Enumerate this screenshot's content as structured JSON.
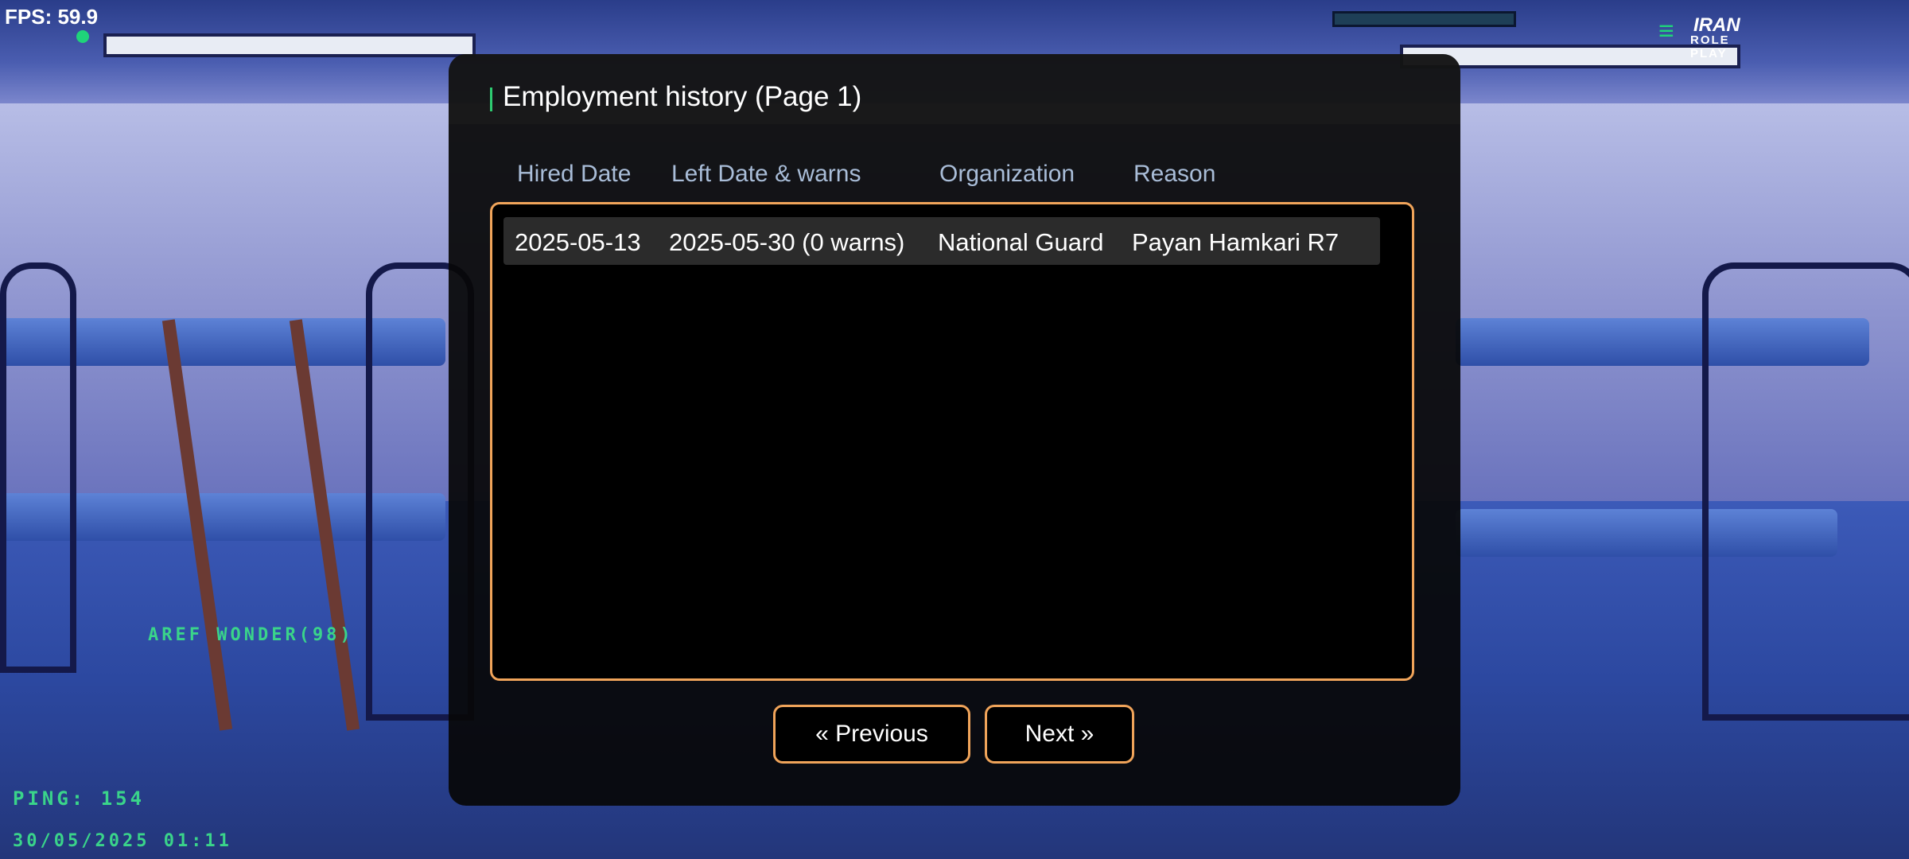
{
  "hud": {
    "fps": "FPS: 59.9",
    "player_tag": "AREF WONDER(98)",
    "ping": "PING: 154",
    "datetime": "30/05/2025 01:11"
  },
  "logo": {
    "mark": "≡",
    "line1": "IRAN",
    "line2": "ROLE PLAY"
  },
  "dialog": {
    "title": "Employment history (Page 1)",
    "columns": [
      "Hired Date",
      "Left Date & warns",
      "Organization",
      "Reason"
    ],
    "rows": [
      {
        "hired": "2025-05-13",
        "left": "2025-05-30 (0 warns)",
        "organization": "National Guard",
        "reason": "Payan Hamkari R7"
      }
    ],
    "buttons": {
      "previous": "« Previous",
      "next": "Next »"
    }
  },
  "colors": {
    "accent_border": "#f0a45a",
    "title_accent": "#2ecc71",
    "hud_text": "#3ad48a"
  }
}
